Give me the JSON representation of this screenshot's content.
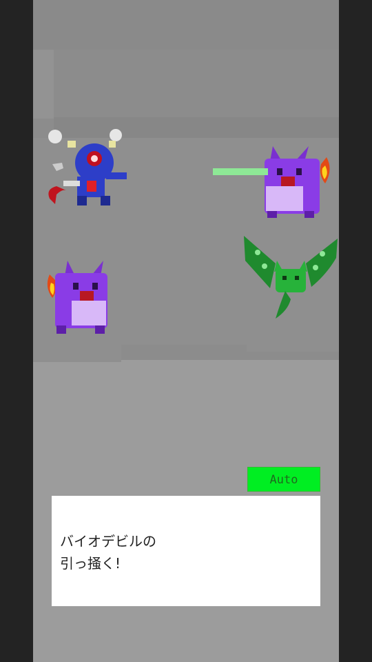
{
  "battle": {
    "allies": [
      {
        "name": "blue-devil-robot",
        "role": "ally"
      },
      {
        "name": "purple-fire-cat",
        "role": "ally"
      }
    ],
    "enemies": [
      {
        "name": "purple-fire-cat",
        "role": "enemy"
      },
      {
        "name": "green-bat",
        "role": "enemy"
      }
    ],
    "beam_color": "#8ee896"
  },
  "controls": {
    "auto_label": "Auto",
    "auto_color": "#00ee22"
  },
  "message": {
    "line1": "バイオデビルの",
    "line2": "引っ掻く!"
  }
}
